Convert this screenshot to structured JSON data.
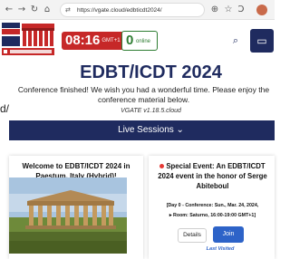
{
  "browser": {
    "back": "←",
    "forward": "→",
    "reload": "↻",
    "home": "⌂",
    "url_icon": "⇄",
    "url": "https://vgate.cloud/edbticdt2024/",
    "zoom": "⊕",
    "star": "☆",
    "extensions": "Ɔ",
    "reader": "☐"
  },
  "header": {
    "clock_time": "08:16",
    "clock_tz": "GMT+1",
    "online_count": "0",
    "online_label": "online",
    "search_glyph": "⌕",
    "menu_glyph": "▭"
  },
  "main": {
    "title": "EDBT/ICDT 2024",
    "message": "Conference finished! We wish you had a wonderful time. Please enjoy the conference material below.",
    "version": "VGATE v1.18.5.cloud",
    "stray_text": "d/",
    "live_sessions_label": "Live Sessions ⌄"
  },
  "welcome_card": {
    "title": "Welcome to EDBT/ICDT 2024 in Paestum, Italy (Hybrid)!"
  },
  "event_card": {
    "title": "Special Event: An EDBT/ICDT 2024 event in the honor of Serge Abiteboul",
    "day": "[Day 0 - Conference: Sun., Mar. 24, 2024,",
    "room": "▸ Room: Saturno, 16:00-19:00 GMT+1]",
    "details_label": "Details",
    "join_label": "Join",
    "last_visited": "Last Visited"
  },
  "colors": {
    "brand_navy": "#1f2b5f",
    "clock_red": "#c62828",
    "online_green": "#2e7d32",
    "join_blue": "#2d63c8"
  }
}
